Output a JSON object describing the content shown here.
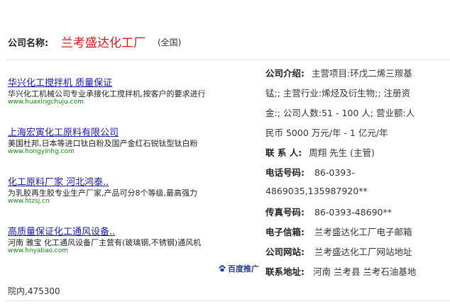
{
  "company": {
    "label": "公司名称:",
    "name": "兰考盛达化工厂",
    "scope": "(全国)"
  },
  "ads": [
    {
      "title": "华兴化工搅拌机 质量保证",
      "desc": "华兴化工机械公司专业承接化工搅拌机,按客户的要求进行",
      "url": "www.huaxingchuju.com"
    },
    {
      "title": "上海宏寅化工原料有限公司",
      "desc": "美国杜邦,日本等进口钛白粉及国产金红石锐钛型钛白粉",
      "url": "www.hongyinhg.com"
    },
    {
      "title": "化工原料厂家 河北鸿泰..",
      "desc": "为乳胶再生胶专业生产厂家,产品可分8个等级,最高强力",
      "url": "www.htzsj.cn"
    },
    {
      "title": "高质量保证化工通风设备..",
      "desc": "河南 雅宝 化工通风设备厂主营有(玻璃钢,不锈钢)通风机",
      "url": "www.hnyabao.com"
    }
  ],
  "baidu_promo": "百度推广",
  "info": {
    "intro_label": "公司介绍:",
    "intro_line1": "主营项目:环戊二烯三羰基",
    "intro_line2": "锰;; 主营行业:烯烃及衍生物;; 注册资",
    "intro_line3": "金:; 公司人数:51 - 100 人; 营业额:人",
    "intro_line4": "民币 5000 万元/年 - 1 亿元/年",
    "contact_label": "联 系 人:",
    "contact_value": "周翔 先生 (主管)",
    "phone_label": "电话号码:",
    "phone_value1": "86-0393-",
    "phone_value2": "4869035,135987920**",
    "fax_label": "传真号码:",
    "fax_value": "86-0393-48690**",
    "email_label": "电子信箱:",
    "email_value": "兰考盛达化工厂电子邮箱",
    "website_label": "公司网站:",
    "website_value": "兰考盛达化工厂网站地址",
    "address_label": "联系地址:",
    "address_value": "河南 兰考县 兰考石油基地",
    "address_tail": "院内,475300"
  }
}
